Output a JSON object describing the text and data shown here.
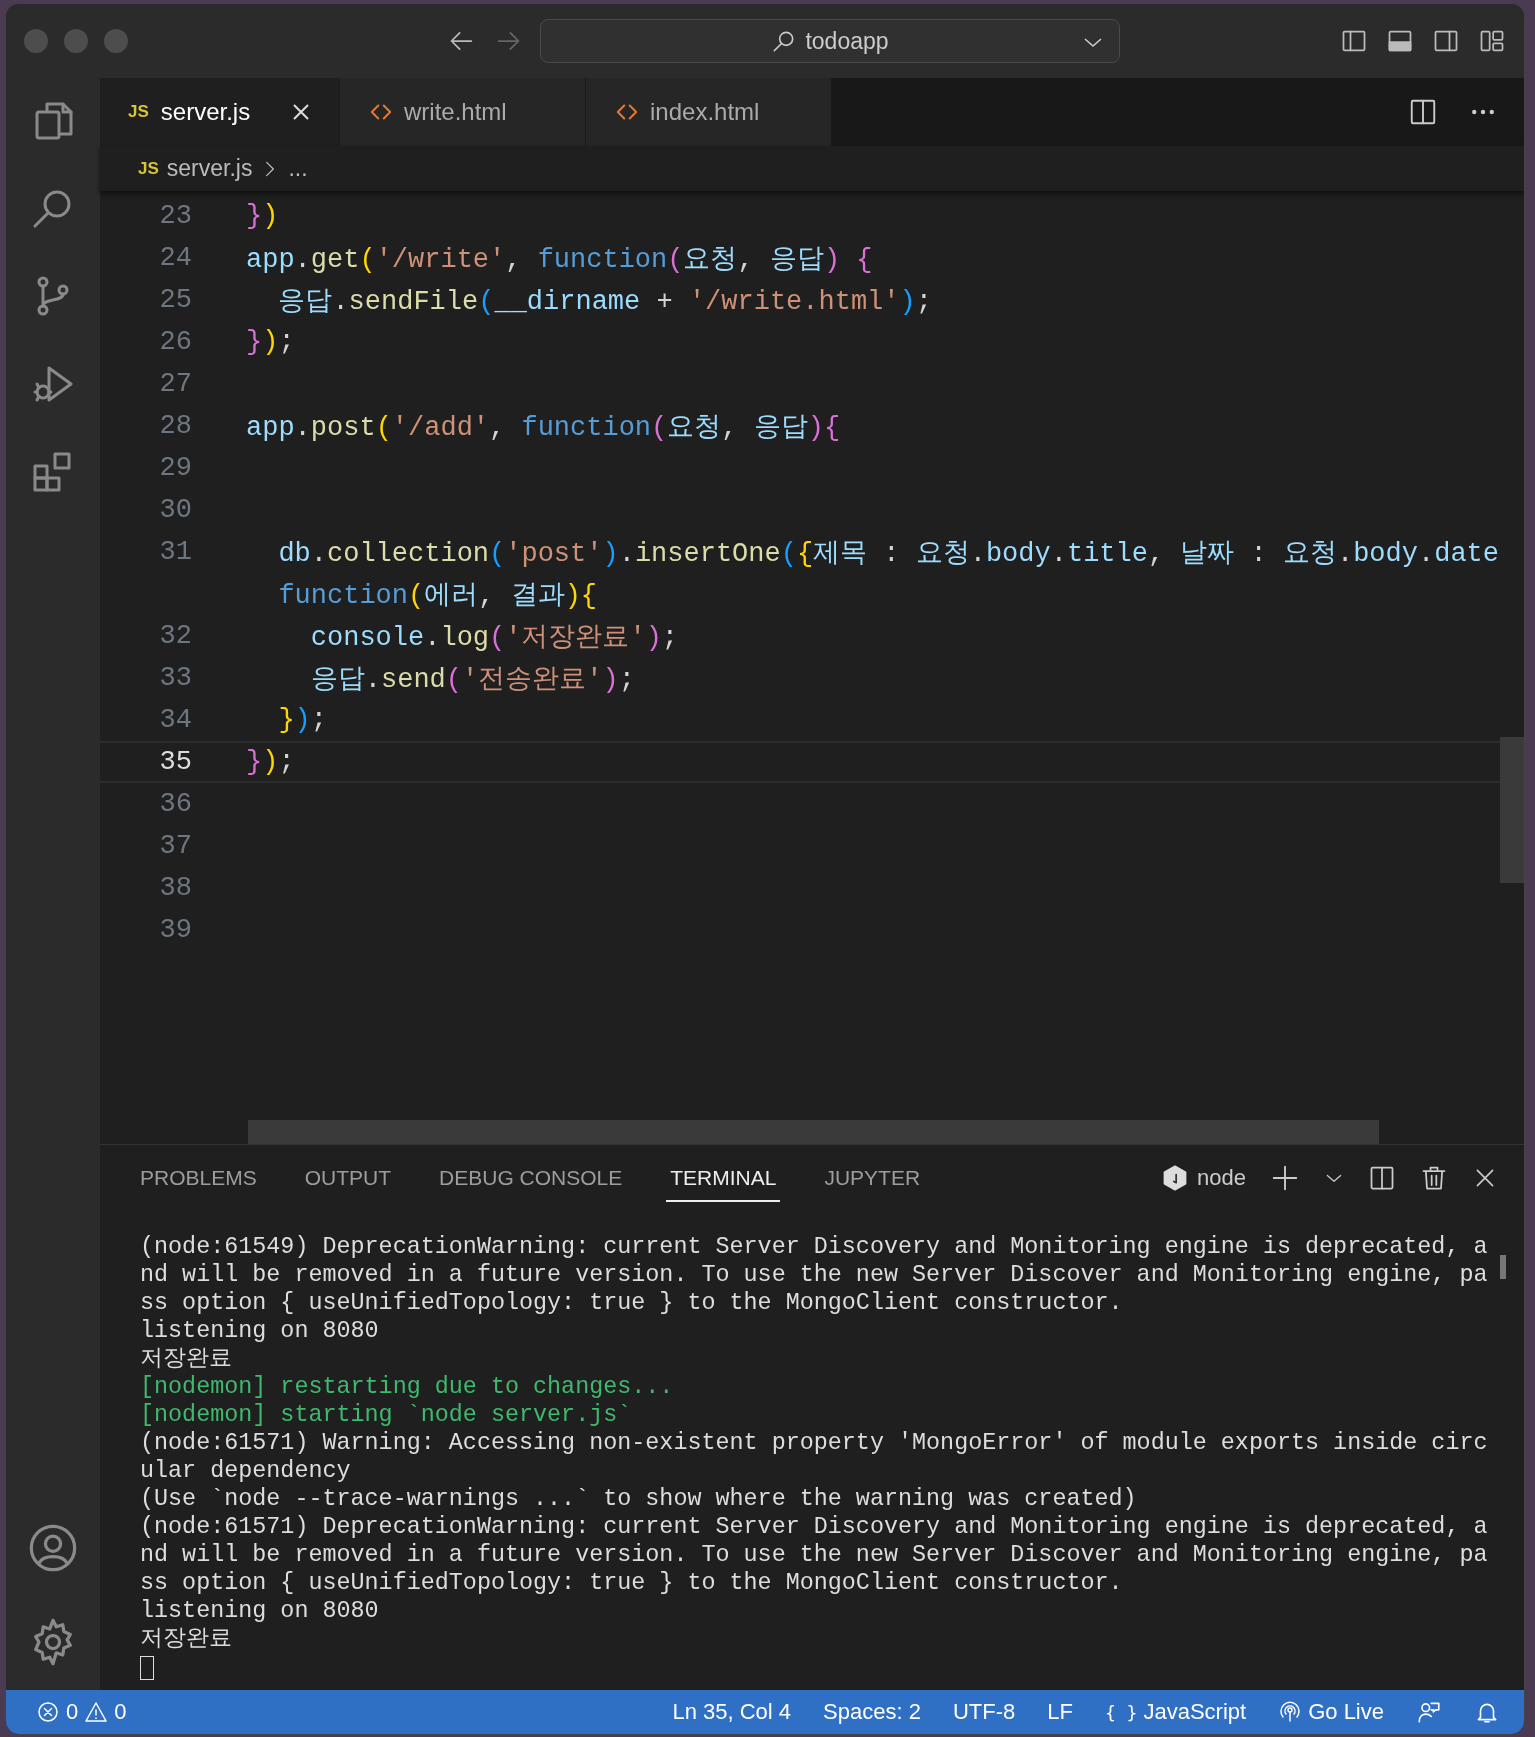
{
  "title_bar": {
    "search": "todoapp"
  },
  "tabs": [
    {
      "label": "server.js",
      "kind": "js",
      "icon_text": "JS",
      "selected": true
    },
    {
      "label": "write.html",
      "kind": "html",
      "selected": false
    },
    {
      "label": "index.html",
      "kind": "html",
      "selected": false
    }
  ],
  "breadcrumb": {
    "icon_text": "JS",
    "file": "server.js",
    "more": "..."
  },
  "editor": {
    "lines": [
      {
        "number": "23",
        "current": false,
        "tokens": [
          {
            "text": "}",
            "kind": "b2"
          },
          {
            "text": ")",
            "kind": "b1"
          }
        ]
      },
      {
        "number": "24",
        "current": false,
        "tokens": [
          {
            "text": "app",
            "kind": "var"
          },
          {
            "text": ".",
            "kind": "p"
          },
          {
            "text": "get",
            "kind": "func"
          },
          {
            "text": "(",
            "kind": "b1"
          },
          {
            "text": "'/write'",
            "kind": "str"
          },
          {
            "text": ", ",
            "kind": "p"
          },
          {
            "text": "function",
            "kind": "kw"
          },
          {
            "text": "(",
            "kind": "b2"
          },
          {
            "text": "요청",
            "kind": "var"
          },
          {
            "text": ", ",
            "kind": "p"
          },
          {
            "text": "응답",
            "kind": "var"
          },
          {
            "text": ")",
            "kind": "b2"
          },
          {
            "text": " {",
            "kind": "b2"
          }
        ]
      },
      {
        "number": "25",
        "current": false,
        "tokens": [
          {
            "text": "  응답",
            "kind": "var"
          },
          {
            "text": ".",
            "kind": "p"
          },
          {
            "text": "sendFile",
            "kind": "func"
          },
          {
            "text": "(",
            "kind": "b3"
          },
          {
            "text": "__dirname",
            "kind": "var"
          },
          {
            "text": " + ",
            "kind": "p"
          },
          {
            "text": "'/write.html'",
            "kind": "str"
          },
          {
            "text": ")",
            "kind": "b3"
          },
          {
            "text": ";",
            "kind": "p"
          }
        ]
      },
      {
        "number": "26",
        "current": false,
        "tokens": [
          {
            "text": "}",
            "kind": "b2"
          },
          {
            "text": ")",
            "kind": "b1"
          },
          {
            "text": ";",
            "kind": "p"
          }
        ]
      },
      {
        "number": "27",
        "current": false
      },
      {
        "number": "28",
        "current": false,
        "tokens": [
          {
            "text": "app",
            "kind": "var"
          },
          {
            "text": ".",
            "kind": "p"
          },
          {
            "text": "post",
            "kind": "func"
          },
          {
            "text": "(",
            "kind": "b1"
          },
          {
            "text": "'/add'",
            "kind": "str"
          },
          {
            "text": ", ",
            "kind": "p"
          },
          {
            "text": "function",
            "kind": "kw"
          },
          {
            "text": "(",
            "kind": "b2"
          },
          {
            "text": "요청",
            "kind": "var"
          },
          {
            "text": ", ",
            "kind": "p"
          },
          {
            "text": "응답",
            "kind": "var"
          },
          {
            "text": ")",
            "kind": "b2"
          },
          {
            "text": "{",
            "kind": "b2"
          }
        ]
      },
      {
        "number": "29",
        "current": false
      },
      {
        "number": "30",
        "current": false
      },
      {
        "number": "31",
        "current": false,
        "tokens": [
          {
            "text": "  db",
            "kind": "var"
          },
          {
            "text": ".",
            "kind": "p"
          },
          {
            "text": "collection",
            "kind": "func"
          },
          {
            "text": "(",
            "kind": "b3"
          },
          {
            "text": "'post'",
            "kind": "str"
          },
          {
            "text": ")",
            "kind": "b3"
          },
          {
            "text": ".",
            "kind": "p"
          },
          {
            "text": "insertOne",
            "kind": "func"
          },
          {
            "text": "(",
            "kind": "b3"
          },
          {
            "text": "{",
            "kind": "b1"
          },
          {
            "text": "제목",
            "kind": "var"
          },
          {
            "text": " : ",
            "kind": "p"
          },
          {
            "text": "요청",
            "kind": "var"
          },
          {
            "text": ".",
            "kind": "p"
          },
          {
            "text": "body",
            "kind": "var"
          },
          {
            "text": ".",
            "kind": "p"
          },
          {
            "text": "title",
            "kind": "var"
          },
          {
            "text": ", ",
            "kind": "p"
          },
          {
            "text": "날짜",
            "kind": "var"
          },
          {
            "text": " : ",
            "kind": "p"
          },
          {
            "text": "요청",
            "kind": "var"
          },
          {
            "text": ".",
            "kind": "p"
          },
          {
            "text": "body",
            "kind": "var"
          },
          {
            "text": ".",
            "kind": "p"
          },
          {
            "text": "date",
            "kind": "var"
          }
        ]
      },
      {
        "tokens": [
          {
            "text": "  function",
            "kind": "kw"
          },
          {
            "text": "(",
            "kind": "b1"
          },
          {
            "text": "에러",
            "kind": "var"
          },
          {
            "text": ", ",
            "kind": "p"
          },
          {
            "text": "결과",
            "kind": "var"
          },
          {
            "text": ")",
            "kind": "b1"
          },
          {
            "text": "{",
            "kind": "b1"
          }
        ]
      },
      {
        "number": "32",
        "current": false,
        "tokens": [
          {
            "text": "    console",
            "kind": "var"
          },
          {
            "text": ".",
            "kind": "p"
          },
          {
            "text": "log",
            "kind": "func"
          },
          {
            "text": "(",
            "kind": "b2"
          },
          {
            "text": "'저장완료'",
            "kind": "str"
          },
          {
            "text": ")",
            "kind": "b2"
          },
          {
            "text": ";",
            "kind": "p"
          }
        ]
      },
      {
        "number": "33",
        "current": false,
        "tokens": [
          {
            "text": "    응답",
            "kind": "var"
          },
          {
            "text": ".",
            "kind": "p"
          },
          {
            "text": "send",
            "kind": "func"
          },
          {
            "text": "(",
            "kind": "b2"
          },
          {
            "text": "'전송완료'",
            "kind": "str"
          },
          {
            "text": ")",
            "kind": "b2"
          },
          {
            "text": ";",
            "kind": "p"
          }
        ]
      },
      {
        "number": "34",
        "current": false,
        "tokens": [
          {
            "text": "  }",
            "kind": "b1"
          },
          {
            "text": ")",
            "kind": "b3"
          },
          {
            "text": ";",
            "kind": "p"
          }
        ]
      },
      {
        "number": "35",
        "current": true,
        "tokens": [
          {
            "text": "}",
            "kind": "b2"
          },
          {
            "text": ")",
            "kind": "b1"
          },
          {
            "text": ";",
            "kind": "p"
          }
        ]
      },
      {
        "number": "36",
        "current": false
      },
      {
        "number": "37",
        "current": false
      },
      {
        "number": "38",
        "current": false
      },
      {
        "number": "39",
        "current": false
      }
    ]
  },
  "panel": {
    "tabs": [
      {
        "label": "PROBLEMS",
        "selected": false
      },
      {
        "label": "OUTPUT",
        "selected": false
      },
      {
        "label": "DEBUG CONSOLE",
        "selected": false
      },
      {
        "label": "TERMINAL",
        "selected": true
      },
      {
        "label": "JUPYTER",
        "selected": false
      }
    ],
    "terminal_name": "node",
    "terminal_lines": [
      {
        "text": "(node:61549) DeprecationWarning: current Server Discovery and Monitoring engine is deprecated, a",
        "kind": "normal"
      },
      {
        "text": "nd will be removed in a future version. To use the new Server Discover and Monitoring engine, pa",
        "kind": "normal"
      },
      {
        "text": "ss option { useUnifiedTopology: true } to the MongoClient constructor.",
        "kind": "normal"
      },
      {
        "text": "listening on 8080",
        "kind": "normal"
      },
      {
        "text": "저장완료",
        "kind": "normal"
      },
      {
        "text": "[nodemon] restarting due to changes...",
        "kind": "nodemon"
      },
      {
        "text": "[nodemon] starting `node server.js`",
        "kind": "nodemon"
      },
      {
        "text": "(node:61571) Warning: Accessing non-existent property 'MongoError' of module exports inside circ",
        "kind": "normal"
      },
      {
        "text": "ular dependency",
        "kind": "normal"
      },
      {
        "text": "(Use `node --trace-warnings ...` to show where the warning was created)",
        "kind": "normal"
      },
      {
        "text": "(node:61571) DeprecationWarning: current Server Discovery and Monitoring engine is deprecated, a",
        "kind": "normal"
      },
      {
        "text": "nd will be removed in a future version. To use the new Server Discover and Monitoring engine, pa",
        "kind": "normal"
      },
      {
        "text": "ss option { useUnifiedTopology: true } to the MongoClient constructor.",
        "kind": "normal"
      },
      {
        "text": "listening on 8080",
        "kind": "normal"
      },
      {
        "text": "저장완료",
        "kind": "normal"
      }
    ]
  },
  "status_bar": {
    "errors": "0",
    "warnings": "0",
    "items": [
      "Ln 35, Col 4",
      "Spaces: 2",
      "UTF-8",
      "LF"
    ],
    "language_icon": "{ }",
    "language": "JavaScript",
    "go_live": "Go Live"
  }
}
